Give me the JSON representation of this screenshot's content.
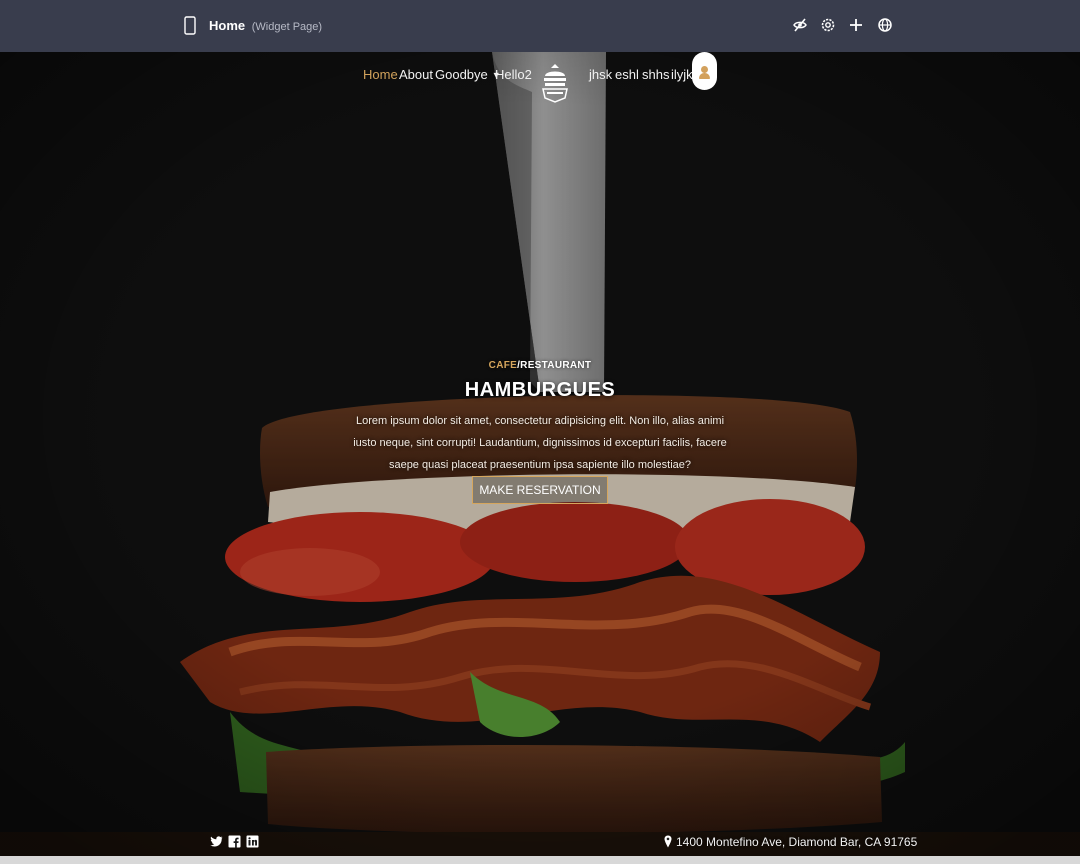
{
  "editor": {
    "page_name": "Home",
    "page_type": "(Widget Page)",
    "icons": [
      "device-phone-icon",
      "eye-off-icon",
      "settings-icon",
      "plus-icon",
      "globe-icon"
    ]
  },
  "nav": {
    "items": [
      {
        "label": "Home",
        "active": true
      },
      {
        "label": "About"
      },
      {
        "label": "Goodbye",
        "has_dropdown": true
      },
      {
        "label": "Hello2"
      },
      {
        "label": "jhsk"
      },
      {
        "label": "eshl"
      },
      {
        "label": "shhs"
      },
      {
        "label": "ilyjk"
      }
    ],
    "logo_icon": "hamburger-logo-icon",
    "avatar_icon": "user-avatar-icon"
  },
  "hero": {
    "eyebrow_accent": "CAFE",
    "eyebrow_rest": "/RESTAURANT",
    "title": "HAMBURGUES",
    "description": "Lorem ipsum dolor sit amet, consectetur adipisicing elit. Non illo, alias animi iusto neque, sint corrupti! Laudantium, dignissimos id excepturi facilis, facere saepe quasi placeat praesentium ipsa sapiente illo molestiae?",
    "cta_label": "MAKE RESERVATION"
  },
  "footer": {
    "social": [
      "twitter-icon",
      "facebook-icon",
      "linkedin-icon"
    ],
    "address": "1400 Montefino Ave, Diamond Bar, CA 91765"
  },
  "colors": {
    "editor_bar": "#393d4d",
    "accent": "#d6a65d",
    "background": "#141414"
  }
}
